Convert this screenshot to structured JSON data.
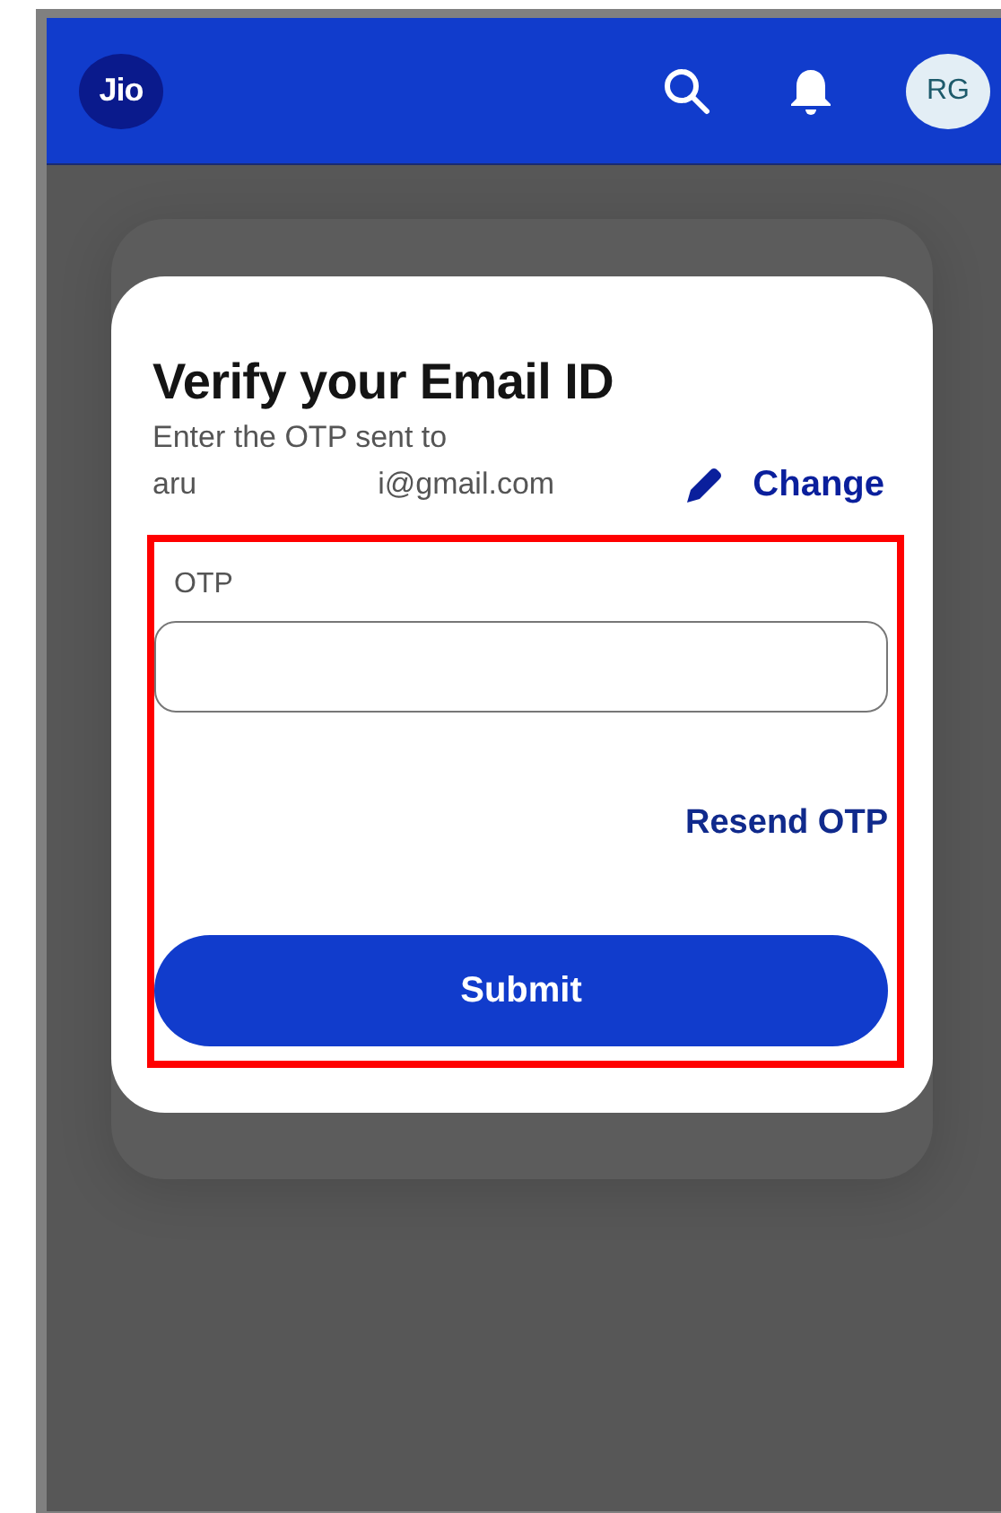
{
  "header": {
    "logo": "Jio",
    "avatar": "RG"
  },
  "dialog": {
    "title": "Verify your Email ID",
    "message": "Enter the OTP sent to",
    "email_start": "aru",
    "email_end": "i@gmail.com",
    "change_link": "Change",
    "otp_field": {
      "label": "OTP"
    },
    "resend_link": "Resend OTP",
    "submit_button": "Submit"
  },
  "annotation": {
    "kind": "outline"
  }
}
